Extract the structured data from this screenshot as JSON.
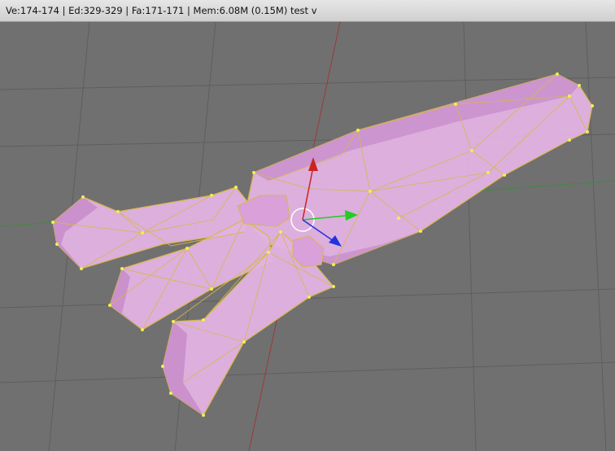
{
  "statusbar": {
    "text": "Ve:174-174 | Ed:329-329 | Fa:171-171 | Mem:6.08M (0.15M) test v"
  },
  "viewport": {
    "background_color": "#707070",
    "grid_color": "#5e5e5e",
    "x_axis_color": "#3f8a3f",
    "y_axis_color": "#9a3a3a",
    "mesh_fill_color": "#e3b2e3",
    "mesh_shade_color": "#c58ac9",
    "edge_color": "#d6b84a",
    "vertex_color": "#f0f050",
    "gizmo": {
      "x_arrow_color": "#22cc22",
      "y_arrow_color": "#cc2222",
      "z_arrow_color": "#2233dd",
      "ring_color": "#ffffff"
    }
  }
}
